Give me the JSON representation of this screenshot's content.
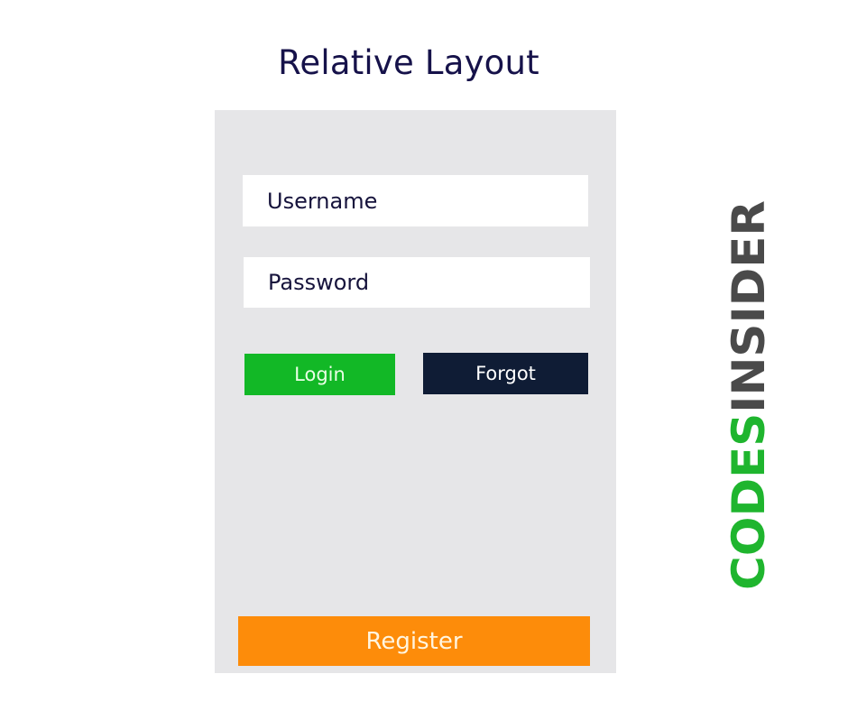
{
  "title": "Relative Layout",
  "form": {
    "username_placeholder": "Username",
    "password_placeholder": "Password",
    "login_label": "Login",
    "forgot_label": "Forgot",
    "register_label": "Register"
  },
  "brand": {
    "part1": "CODES",
    "part2": "INSIDER",
    "part1_color": "#1fb52e",
    "part2_color": "#4a4a4a"
  }
}
